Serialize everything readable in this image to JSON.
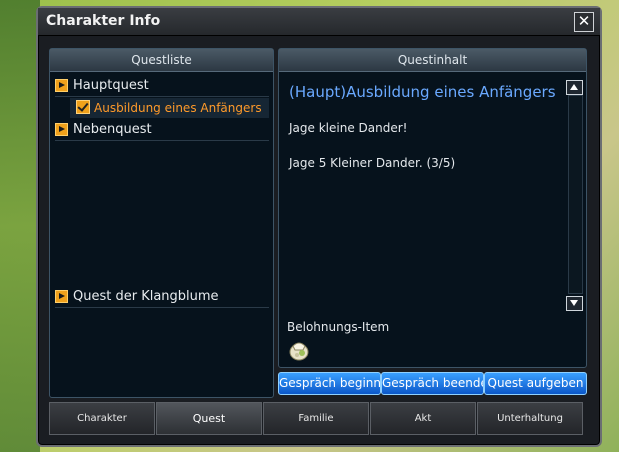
{
  "window": {
    "title": "Charakter Info"
  },
  "quest_list": {
    "header": "Questliste",
    "main_quest": "Hauptquest",
    "main_quest_item": "Ausbildung eines Anfängers",
    "side_quest": "Nebenquest",
    "special_quest": "Quest der Klangblume"
  },
  "quest_content": {
    "header": "Questinhalt",
    "title": "(Haupt)Ausbildung eines Anfängers",
    "line1": "Jage kleine Dander!",
    "line2": "Jage 5 Kleiner Dander. (3/5)",
    "reward_label": "Belohnungs-Item"
  },
  "actions": {
    "start_dialog": "Gespräch beginnen",
    "end_dialog": "Gespräch beenden",
    "abandon_quest": "Quest aufgeben"
  },
  "tabs": [
    "Charakter",
    "Quest",
    "Familie",
    "Akt",
    "Unterhaltung"
  ],
  "active_tab": "Quest",
  "colors": {
    "accent": "#6aa9ff",
    "quest_active": "#ff9a2a",
    "button": "#1a72e8"
  },
  "icons": [
    "close-icon",
    "arrow-right-icon",
    "checkbox-icon",
    "scroll-up-icon",
    "scroll-down-icon",
    "reward-item-icon"
  ]
}
